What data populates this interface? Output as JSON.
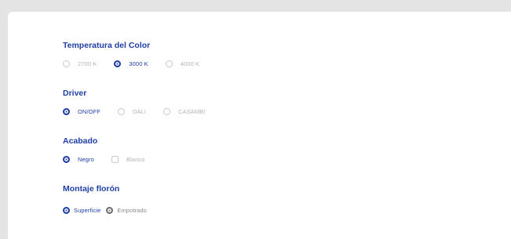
{
  "groups": [
    {
      "title": "Temperatura del Color",
      "options": [
        {
          "label": "2700 K",
          "selected": false
        },
        {
          "label": "3000 K",
          "selected": true
        },
        {
          "label": "4000 K",
          "selected": false
        }
      ]
    },
    {
      "title": "Driver",
      "options": [
        {
          "label": "ON/OFF",
          "selected": true
        },
        {
          "label": "DALI",
          "selected": false
        },
        {
          "label": "CASAMBI",
          "selected": false
        }
      ]
    },
    {
      "title": "Acabado",
      "options": [
        {
          "label": "Negro",
          "selected": true
        },
        {
          "label": "Blanco",
          "selected": false
        }
      ]
    },
    {
      "title": "Montaje florón",
      "options": [
        {
          "label": "Superficie",
          "selected": true
        },
        {
          "label": "Empotrado",
          "selected": true
        }
      ]
    }
  ],
  "colors": {
    "accent": "#1f3fa6",
    "muted": "#b3b3b3",
    "page_bg": "#e4e4e4",
    "card_bg": "#ffffff"
  }
}
